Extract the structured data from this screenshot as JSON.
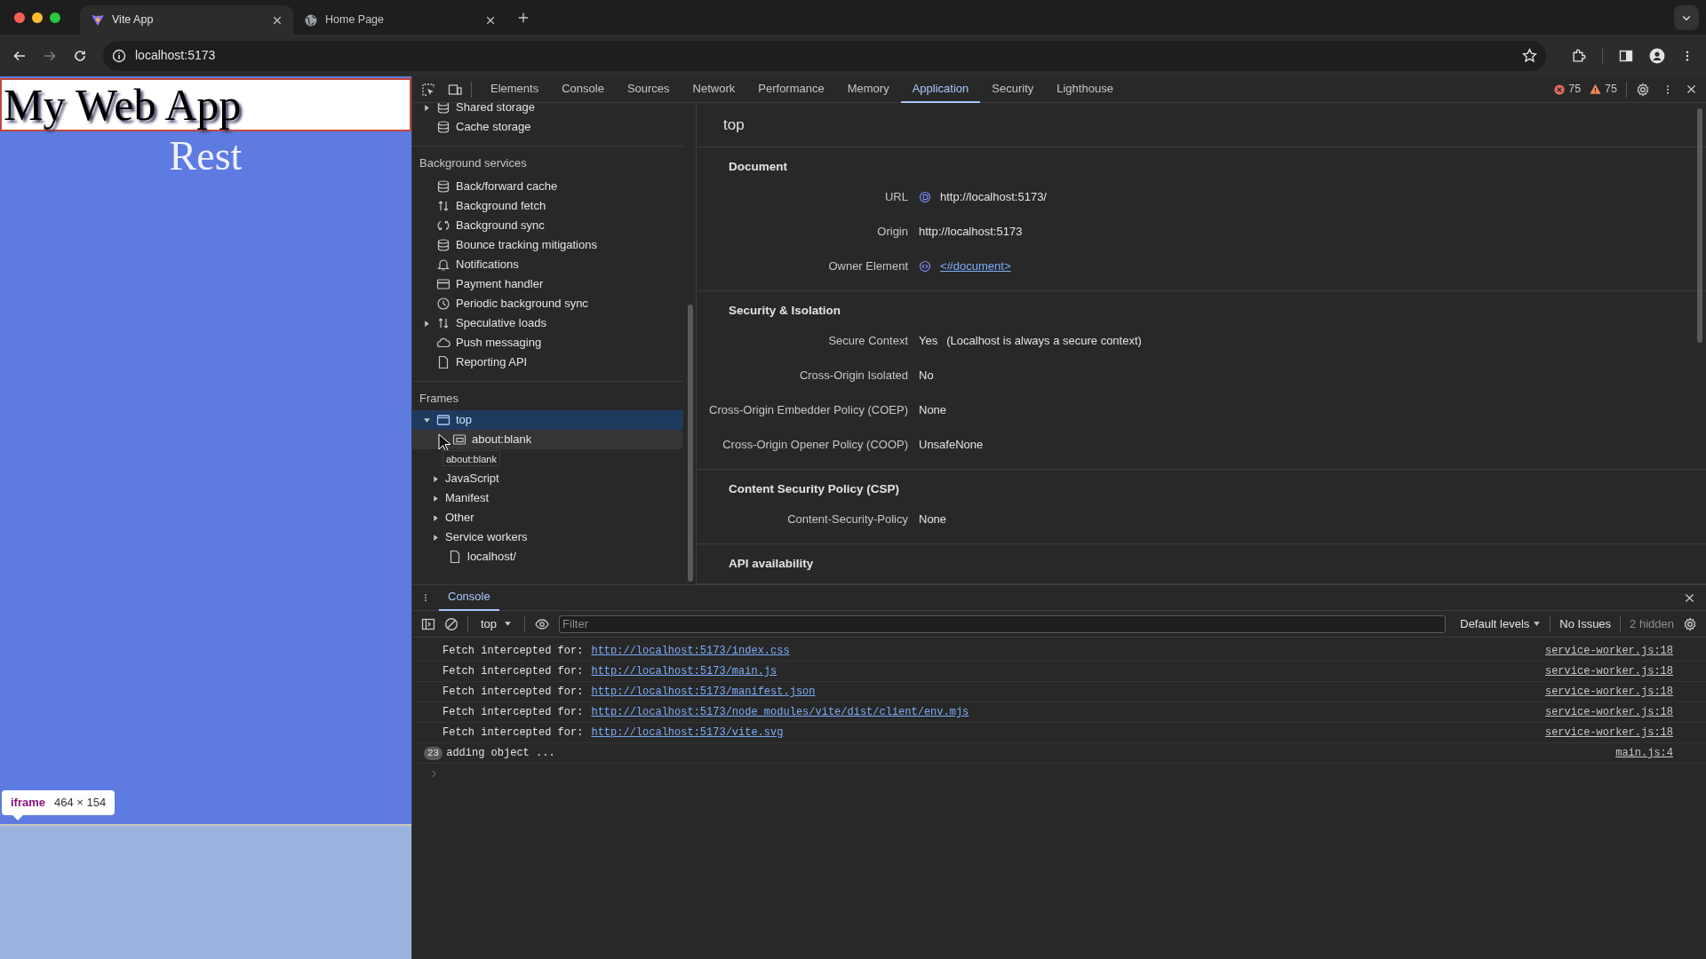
{
  "browser": {
    "tabs": [
      {
        "title": "Vite App",
        "kind": "vite",
        "selected": true
      },
      {
        "title": "Home Page",
        "kind": "globe",
        "selected": false
      }
    ],
    "address": "localhost:5173"
  },
  "page": {
    "heading": "My Web App",
    "text": "Rest",
    "tooltip": {
      "tag": "iframe",
      "size": "464 × 154"
    }
  },
  "devtools": {
    "tabs": [
      {
        "label": "Elements",
        "selected": false
      },
      {
        "label": "Console",
        "selected": false
      },
      {
        "label": "Sources",
        "selected": false
      },
      {
        "label": "Network",
        "selected": false
      },
      {
        "label": "Performance",
        "selected": false
      },
      {
        "label": "Memory",
        "selected": false
      },
      {
        "label": "Application",
        "selected": true
      },
      {
        "label": "Security",
        "selected": false
      },
      {
        "label": "Lighthouse",
        "selected": false
      }
    ],
    "errors": "75",
    "warnings": "75",
    "sidebar": {
      "storage": [
        {
          "label": "Shared storage",
          "kind": "database",
          "expanded": false
        },
        {
          "label": "Cache storage",
          "kind": "database"
        }
      ],
      "background_services": {
        "title": "Background services",
        "items": [
          {
            "label": "Back/forward cache",
            "kind": "database"
          },
          {
            "label": "Background fetch",
            "kind": "transfer"
          },
          {
            "label": "Background sync",
            "kind": "sync"
          },
          {
            "label": "Bounce tracking mitigations",
            "kind": "database"
          },
          {
            "label": "Notifications",
            "kind": "bell"
          },
          {
            "label": "Payment handler",
            "kind": "card"
          },
          {
            "label": "Periodic background sync",
            "kind": "clock"
          },
          {
            "label": "Speculative loads",
            "kind": "transfer",
            "expanded": false
          },
          {
            "label": "Push messaging",
            "kind": "cloud"
          },
          {
            "label": "Reporting API",
            "kind": "file"
          }
        ]
      },
      "frames": {
        "title": "Frames",
        "tree": [
          {
            "label": "top",
            "kind": "frame",
            "expanded": true,
            "selected": true,
            "children": [
              {
                "label": "about:blank",
                "kind": "iframe",
                "selected": false,
                "hovered": true,
                "tooltip": "about:blank"
              },
              {
                "label": "JavaScript",
                "expanded": false,
                "selected": false
              },
              {
                "label": "Manifest",
                "expanded": false,
                "selected": false
              },
              {
                "label": "Other",
                "expanded": false,
                "selected": false
              },
              {
                "label": "Service workers",
                "expanded": false,
                "selected": false,
                "children": [
                  {
                    "label": "localhost/",
                    "kind": "file",
                    "selected": false
                  }
                ]
              }
            ]
          }
        ]
      }
    },
    "details": {
      "title": "top",
      "sections": [
        {
          "title": "Document",
          "rows": [
            {
              "label": "URL",
              "value": "http://localhost:5173/",
              "kind": "icon"
            },
            {
              "label": "Origin",
              "value": "http://localhost:5173",
              "kind": "plain"
            },
            {
              "label": "Owner Element",
              "value": "<#document>",
              "kind": "link"
            }
          ]
        },
        {
          "title": "Security & Isolation",
          "rows": [
            {
              "label": "Secure Context",
              "value": "Yes",
              "note": "(Localhost is always a secure context)",
              "kind": "plain"
            },
            {
              "label": "Cross-Origin Isolated",
              "value": "No",
              "kind": "plain"
            },
            {
              "label": "Cross-Origin Embedder Policy (COEP)",
              "value": "None",
              "kind": "plain"
            },
            {
              "label": "Cross-Origin Opener Policy (COOP)",
              "value": "UnsafeNone",
              "kind": "plain"
            }
          ]
        },
        {
          "title": "Content Security Policy (CSP)",
          "rows": [
            {
              "label": "Content-Security-Policy",
              "value": "None",
              "kind": "plain"
            }
          ]
        },
        {
          "title": "API availability"
        }
      ]
    },
    "console": {
      "tab": "Console",
      "context": "top",
      "filter_placeholder": "Filter",
      "levels": "Default levels",
      "issues": "No Issues",
      "hidden": "2 hidden",
      "messages": [
        {
          "text": "Fetch intercepted for:",
          "link": "http://localhost:5173/index.css",
          "source": "service-worker.js:18"
        },
        {
          "text": "Fetch intercepted for:",
          "link": "http://localhost:5173/main.js",
          "source": "service-worker.js:18"
        },
        {
          "text": "Fetch intercepted for:",
          "link": "http://localhost:5173/manifest.json",
          "source": "service-worker.js:18"
        },
        {
          "text": "Fetch intercepted for:",
          "link": "http://localhost:5173/node_modules/vite/dist/client/env.mjs",
          "source": "service-worker.js:18"
        },
        {
          "text": "Fetch intercepted for:",
          "link": "http://localhost:5173/vite.svg",
          "source": "service-worker.js:18"
        },
        {
          "count": "23",
          "text": "adding object ...",
          "source": "main.js:4"
        }
      ]
    }
  }
}
